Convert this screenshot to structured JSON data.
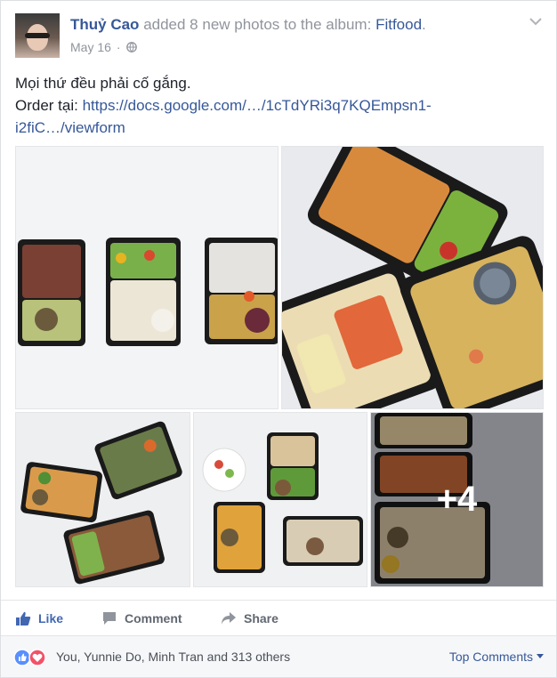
{
  "post": {
    "author": "Thuỷ Cao",
    "action": "added 8 new photos to the album:",
    "album": "Fitfood",
    "suffix": ".",
    "date": "May 16",
    "dot": "·",
    "privacy_icon": "globe-icon",
    "menu_icon": "chevron-down-icon"
  },
  "body": {
    "line1": "Mọi thứ đều phải cố gắng.",
    "order_prefix": "Order tại: ",
    "link_text_1": "https://docs.google.com/…/1cTdYRi3q7KQEmpsn1-",
    "link_text_2": "i2fiC…/viewform"
  },
  "photos": {
    "count_total": 8,
    "more_label": "+4"
  },
  "actions": {
    "like": "Like",
    "comment": "Comment",
    "share": "Share"
  },
  "reactions": {
    "summary": "You, Yunnie Do, Minh Tran and 313 others",
    "top_comments": "Top Comments",
    "like_color": "#5890ff",
    "love_color": "#f25268"
  },
  "colors": {
    "link": "#365899",
    "meta": "#90949c",
    "text": "#1d2129"
  }
}
